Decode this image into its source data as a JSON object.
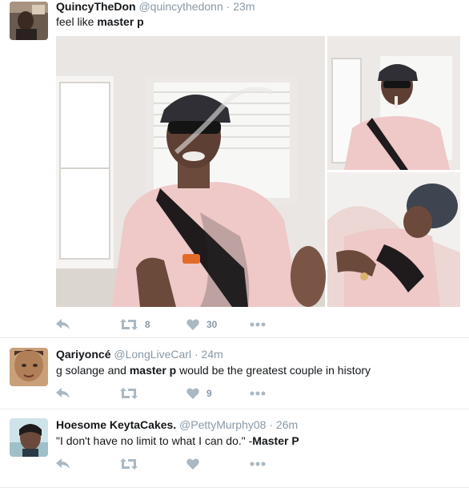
{
  "tweets": [
    {
      "name": "QuincyTheDon",
      "handle": "@quincythedonn",
      "time": "23m",
      "text_plain": "feel like ",
      "text_bold": "master p",
      "retweets": "8",
      "likes": "30"
    },
    {
      "name": "Qariyoncé",
      "handle": "@LongLiveCarl",
      "time": "24m",
      "text_pre": "g solange and ",
      "text_bold": "master p",
      "text_post": " would be the greatest couple in history",
      "retweets": "",
      "likes": "9"
    },
    {
      "name": "Hoesome KeytaCakes.",
      "handle": "@PettyMurphy08",
      "time": "26m",
      "text_plain": "\"I don't have no limit to what I can do.\" -",
      "text_bold": "Master P",
      "retweets": "",
      "likes": ""
    }
  ],
  "separator": "·",
  "icons": [
    "reply-icon",
    "retweet-icon",
    "heart-icon",
    "more-icon"
  ],
  "colors": {
    "icon": "#aab8c2",
    "muted": "#8899a6",
    "text": "#14171a",
    "border": "#e6ecf0"
  }
}
